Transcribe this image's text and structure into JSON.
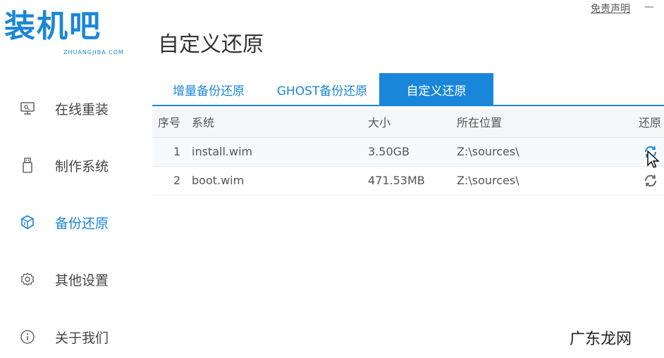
{
  "logo": {
    "main": "装机吧",
    "sub": "ZHUANGJIBA.COM"
  },
  "header": {
    "disclaimer": "免责声明",
    "minimize": "—"
  },
  "page_title": "自定义还原",
  "sidebar": {
    "items": [
      {
        "label": "在线重装",
        "icon": "monitor-icon",
        "active": false
      },
      {
        "label": "制作系统",
        "icon": "usb-icon",
        "active": false
      },
      {
        "label": "备份还原",
        "icon": "backup-cube-icon",
        "active": true
      },
      {
        "label": "其他设置",
        "icon": "gear-icon",
        "active": false
      },
      {
        "label": "关于我们",
        "icon": "info-icon",
        "active": false
      }
    ]
  },
  "tabs": [
    {
      "label": "增量备份还原",
      "active": false
    },
    {
      "label": "GHOST备份还原",
      "active": false
    },
    {
      "label": "自定义还原",
      "active": true
    }
  ],
  "table": {
    "headers": {
      "index": "序号",
      "system": "系统",
      "size": "大小",
      "location": "所在位置",
      "restore": "还原"
    },
    "rows": [
      {
        "index": "1",
        "system": "install.wim",
        "size": "3.50GB",
        "location": "Z:\\sources\\"
      },
      {
        "index": "2",
        "system": "boot.wim",
        "size": "471.53MB",
        "location": "Z:\\sources\\"
      }
    ]
  },
  "watermark": "广东龙网",
  "colors": {
    "accent": "#1a86d9",
    "text": "#444444",
    "header_bg": "#f5f6f8"
  }
}
